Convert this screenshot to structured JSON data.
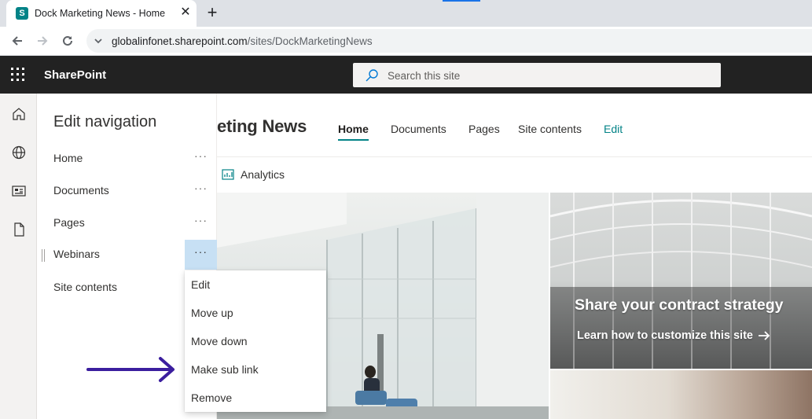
{
  "browser": {
    "tab_title": "Dock Marketing News - Home",
    "favicon_letter": "S",
    "url_host": "globalinfonet.sharepoint.com",
    "url_path": "/sites/DockMarketingNews"
  },
  "suitebar": {
    "brand": "SharePoint",
    "search_placeholder": "Search this site"
  },
  "site": {
    "title_visible": "eting News",
    "nav": [
      "Home",
      "Documents",
      "Pages",
      "Site contents",
      "Edit"
    ],
    "active_nav": "Home",
    "analytics_label": "Analytics"
  },
  "hero": {
    "caption": "Share your contract strategy",
    "link": "Learn how to customize this site"
  },
  "edit_panel": {
    "heading": "Edit navigation",
    "items": [
      {
        "label": "Home",
        "more": "···"
      },
      {
        "label": "Documents",
        "more": "···"
      },
      {
        "label": "Pages",
        "more": "···"
      },
      {
        "label": "Webinars",
        "more": "···",
        "selected": true
      },
      {
        "label": "Site contents"
      }
    ]
  },
  "context_menu": {
    "items": [
      "Edit",
      "Move up",
      "Move down",
      "Make sub link",
      "Remove"
    ]
  },
  "colors": {
    "accent": "#038387",
    "suitebar": "#222222",
    "annotation_arrow": "#3b1e9e",
    "selected_more_bg": "#c7e0f4"
  }
}
